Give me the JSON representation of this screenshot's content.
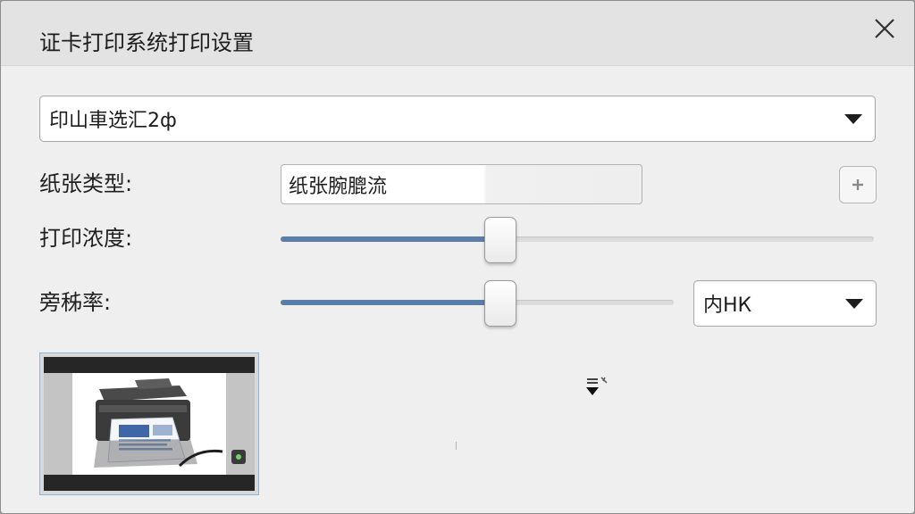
{
  "window": {
    "title": "证卡打印系统打印设置"
  },
  "printer_select": {
    "value": "印山車选汇2ф"
  },
  "paper_type": {
    "label": "纸张类型:",
    "value": "纸张腕膍流"
  },
  "print_density": {
    "label": "打印浓度:",
    "level": 0.37
  },
  "resolution": {
    "label": "旁秭率:",
    "level": 0.56,
    "select_value": "内НК"
  },
  "colors": {
    "accent": "#5b7ea8",
    "background": "#efefef",
    "titlebar": "#e3e3e3"
  },
  "icons": {
    "close": "close-icon",
    "dropdown": "chevron-down-icon",
    "add": "plus-icon",
    "cursor": "pointer-cursor-icon",
    "preview_status": "status-led-icon"
  }
}
